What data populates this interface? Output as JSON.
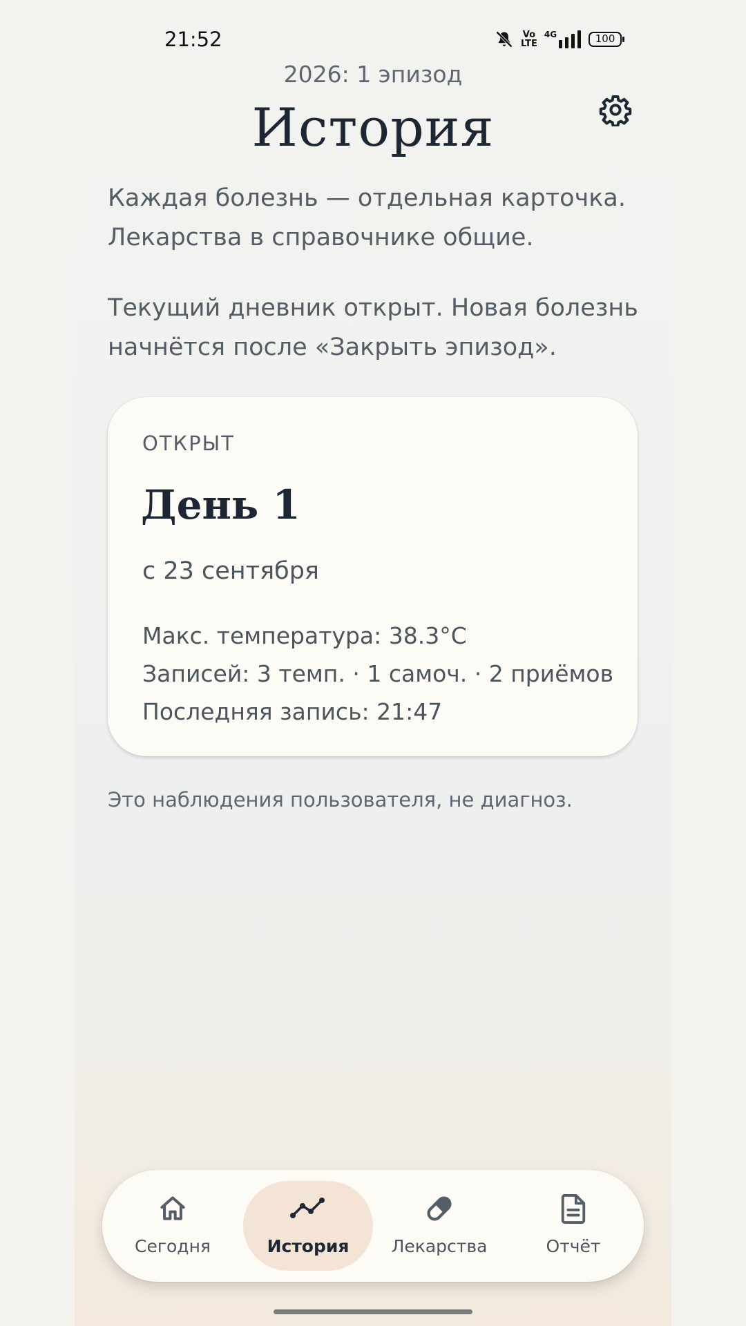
{
  "status_bar": {
    "time": "21:52",
    "icons": [
      "bell-muted-icon",
      "volte-icon",
      "signal-4g-icon"
    ],
    "volte_label_top": "Vo",
    "volte_label_bottom": "LTE",
    "network_label": "4G",
    "battery_level": "100"
  },
  "header": {
    "episode_count": "2026: 1 эпизод",
    "title": "История",
    "settings_icon": "gear-icon"
  },
  "intro": {
    "line1": "Каждая болезнь — отдельная карточка.",
    "line2": "Лекарства в справочнике общие.",
    "line3": "Текущий дневник открыт. Новая болезнь",
    "line4": "начнётся после «Закрыть эпизод»."
  },
  "episode_card": {
    "status": "ОТКРЫТ",
    "title": "День 1",
    "since": "с 23 сентября",
    "max_temp": "Макс. температура: 38.3°C",
    "records": "Записей: 3 темп. · 1 самоч. · 2 приёмов",
    "last_record": "Последняя запись: 21:47"
  },
  "disclaimer": "Это наблюдения пользователя, не диагноз.",
  "bottom_nav": {
    "active": "history",
    "items": [
      {
        "id": "today",
        "label": "Сегодня",
        "icon": "home-icon"
      },
      {
        "id": "history",
        "label": "История",
        "icon": "trend-line-icon"
      },
      {
        "id": "medications",
        "label": "Лекарства",
        "icon": "pill-icon"
      },
      {
        "id": "report",
        "label": "Отчёт",
        "icon": "document-icon"
      }
    ]
  },
  "colors": {
    "background": "#f2f2ef",
    "card": "#fdfbf6",
    "active_nav": "#f3e4d6",
    "text_dark": "#1d2733",
    "text_muted": "#545c64"
  }
}
